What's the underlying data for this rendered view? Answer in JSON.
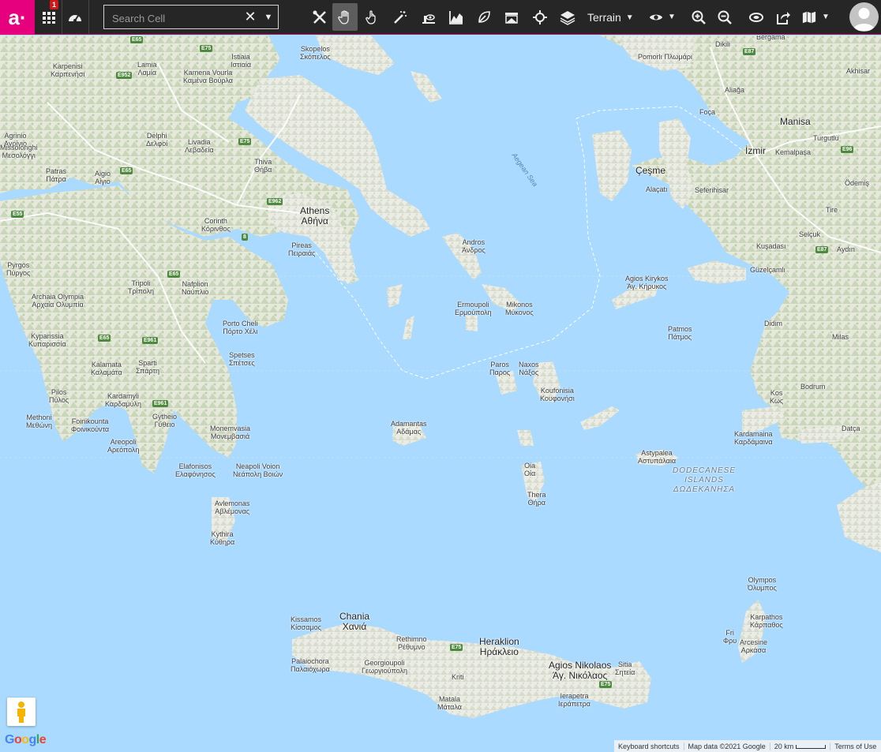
{
  "toolbar": {
    "brand_logo": "a·",
    "apps_badge": "1",
    "search_placeholder": "Search Cell",
    "search_value": "",
    "map_type": "Terrain",
    "icons": [
      "apps-grid-icon",
      "dashboard-gauge-icon",
      "tools-icon",
      "pan-hand-icon",
      "pointer-hand-icon",
      "magic-wand-icon",
      "viewshed-icon",
      "elevation-profile-icon",
      "leaf-icon",
      "coverage-icon",
      "locate-crosshair-icon",
      "layers-icon",
      "eye-icon",
      "zoom-in-icon",
      "zoom-out-icon",
      "overlay-icon",
      "export-icon",
      "map-book-icon",
      "user-avatar-icon"
    ]
  },
  "map": {
    "sea_label": "Aegean Sea",
    "group_label": [
      "DODECANESE",
      "ISLANDS",
      "ΔΩΔΕΚΑΝΗΣΑ"
    ],
    "places": [
      {
        "name": "Skopelos",
        "alt": "Σκόπελος"
      },
      {
        "name": "Istiaia",
        "alt": "Ιστιαία"
      },
      {
        "name": "Lamia",
        "alt": "Λαμία"
      },
      {
        "name": "Karpenisi",
        "alt": "Καρπενήσι"
      },
      {
        "name": "Kamena Vourla",
        "alt": "Καμένα Βούρλα"
      },
      {
        "name": "Delphi",
        "alt": "Δελφοί"
      },
      {
        "name": "Livadia",
        "alt": "Λεβαδεία"
      },
      {
        "name": "Agrinio",
        "alt": "Αγρίνιο"
      },
      {
        "name": "Missolonghi",
        "alt": "Μεσολόγγι"
      },
      {
        "name": "Patras",
        "alt": "Πάτρα"
      },
      {
        "name": "Aigio",
        "alt": "Αίγιο"
      },
      {
        "name": "Thiva",
        "alt": "Θήβα"
      },
      {
        "name": "Athens",
        "alt": "Αθήνα"
      },
      {
        "name": "Pireas",
        "alt": "Πειραιάς"
      },
      {
        "name": "Corinth",
        "alt": "Κόρινθος"
      },
      {
        "name": "Pyrgos",
        "alt": "Πύργος"
      },
      {
        "name": "Archaia Olympia",
        "alt": "Αρχαία Ολυμπία"
      },
      {
        "name": "Tripoli",
        "alt": "Τρίπολη"
      },
      {
        "name": "Nafplion",
        "alt": "Ναύπλιο"
      },
      {
        "name": "Kyparissia",
        "alt": "Κυπαρισσία"
      },
      {
        "name": "Porto Cheli",
        "alt": "Πόρτο Χέλι"
      },
      {
        "name": "Spetses",
        "alt": "Σπέτσες"
      },
      {
        "name": "Kalamata",
        "alt": "Καλαμάτα"
      },
      {
        "name": "Sparti",
        "alt": "Σπάρτη"
      },
      {
        "name": "Pilos",
        "alt": "Πύλος"
      },
      {
        "name": "Kardamyli",
        "alt": "Καρδαμύλη"
      },
      {
        "name": "Methoni",
        "alt": "Μεθώνη"
      },
      {
        "name": "Foinikounta",
        "alt": "Φοινικούντα"
      },
      {
        "name": "Gytheio",
        "alt": "Γύθειο"
      },
      {
        "name": "Areopoli",
        "alt": "Αρεόπολη"
      },
      {
        "name": "Monemvasia",
        "alt": "Μονεμβασιά"
      },
      {
        "name": "Elafonisos",
        "alt": "Ελαφόνησος"
      },
      {
        "name": "Neapoli Voion",
        "alt": "Νεάπολη Βοιών"
      },
      {
        "name": "Avlemonas",
        "alt": "Αβλέμονας"
      },
      {
        "name": "Kythira",
        "alt": "Κύθηρα"
      },
      {
        "name": "Andros",
        "alt": "Άνδρος"
      },
      {
        "name": "Ermoupoli",
        "alt": "Ερμούπολη"
      },
      {
        "name": "Mikonos",
        "alt": "Μύκονος"
      },
      {
        "name": "Paros",
        "alt": "Παρος"
      },
      {
        "name": "Naxos",
        "alt": "Νάξος"
      },
      {
        "name": "Koufonisia",
        "alt": "Κουφονήσι"
      },
      {
        "name": "Adamantas",
        "alt": "Αδάμας"
      },
      {
        "name": "Oia",
        "alt": "Οία"
      },
      {
        "name": "Thera",
        "alt": "Θήρα"
      },
      {
        "name": "Astypalea",
        "alt": "Αστυπάλαια"
      },
      {
        "name": "Patmos",
        "alt": "Πάτμος"
      },
      {
        "name": "Agios Kirykos",
        "alt": "Άγ. Κήρυκος"
      },
      {
        "name": "Kos",
        "alt": "Κως"
      },
      {
        "name": "Kardamaina",
        "alt": "Καρδάμαινα"
      },
      {
        "name": "Chania",
        "alt": "Χανιά"
      },
      {
        "name": "Kissamos",
        "alt": "Κίσσαμος"
      },
      {
        "name": "Rethimno",
        "alt": "Ρέθυμνο"
      },
      {
        "name": "Heraklion",
        "alt": "Ηράκλειο"
      },
      {
        "name": "Agios Nikolaos",
        "alt": "Άγ. Νικόλαος"
      },
      {
        "name": "Sitia",
        "alt": "Σητεία"
      },
      {
        "name": "Palaiochora",
        "alt": "Παλαιόχωρα"
      },
      {
        "name": "Georgioupoli",
        "alt": "Γεωργιούπολη"
      },
      {
        "name": "Kriti",
        "alt": ""
      },
      {
        "name": "Matala",
        "alt": "Μάταλα"
      },
      {
        "name": "Ierapetra",
        "alt": "Ιεράπετρα"
      },
      {
        "name": "Olympos",
        "alt": "Όλυμπος"
      },
      {
        "name": "Karpathos",
        "alt": "Κάρπαθος"
      },
      {
        "name": "Fri",
        "alt": "Φρυ"
      },
      {
        "name": "Arcesine",
        "alt": "Αρκάσα"
      },
      {
        "name": "Dikili",
        "alt": ""
      },
      {
        "name": "Bergama",
        "alt": ""
      },
      {
        "name": "Akhisar",
        "alt": ""
      },
      {
        "name": "Aliağa",
        "alt": ""
      },
      {
        "name": "Foça",
        "alt": ""
      },
      {
        "name": "Manisa",
        "alt": ""
      },
      {
        "name": "Turgutlu",
        "alt": ""
      },
      {
        "name": "İzmir",
        "alt": ""
      },
      {
        "name": "Kemalpaşa",
        "alt": ""
      },
      {
        "name": "Çeşme",
        "alt": ""
      },
      {
        "name": "Alaçatı",
        "alt": ""
      },
      {
        "name": "Seferihisar",
        "alt": ""
      },
      {
        "name": "Ödemiş",
        "alt": ""
      },
      {
        "name": "Tire",
        "alt": ""
      },
      {
        "name": "Selçuk",
        "alt": ""
      },
      {
        "name": "Kuşadası",
        "alt": ""
      },
      {
        "name": "Aydın",
        "alt": ""
      },
      {
        "name": "Güzelçamlı",
        "alt": ""
      },
      {
        "name": "Didim",
        "alt": ""
      },
      {
        "name": "Milas",
        "alt": ""
      },
      {
        "name": "Bodrum",
        "alt": ""
      },
      {
        "name": "Datça",
        "alt": ""
      },
      {
        "name": "Pomorlı Πλωμάρι",
        "alt": ""
      }
    ],
    "road_shields": [
      "E65",
      "E75",
      "E952",
      "E75",
      "E65",
      "E962",
      "8",
      "E55",
      "E65",
      "E65",
      "E961",
      "E961",
      "E87",
      "E87",
      "E96",
      "E75",
      "E75"
    ]
  },
  "attribution": {
    "keyboard": "Keyboard shortcuts",
    "mapdata": "Map data ©2021 Google",
    "scale": "20 km",
    "terms": "Terms of Use"
  },
  "google": [
    "G",
    "o",
    "o",
    "g",
    "l",
    "e"
  ]
}
